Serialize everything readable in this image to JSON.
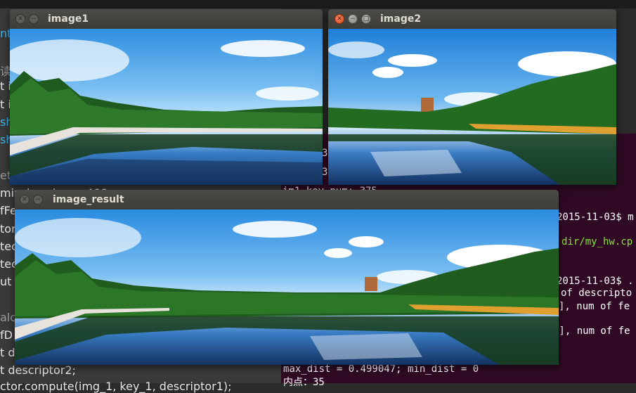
{
  "editor": {
    "lines": [
      {
        "text": "nt",
        "style": "blue"
      },
      {
        "text": "读入",
        "style": "gray"
      },
      {
        "text": "t i",
        "style": ""
      },
      {
        "text": "t i",
        "style": ""
      },
      {
        "text": "sh",
        "style": "blue"
      },
      {
        "text": "sh",
        "style": "blue"
      },
      {
        "text": "et",
        "style": "gray"
      },
      {
        "text": "min_hessian = 400",
        "style": ""
      },
      {
        "text": "fFe",
        "style": ""
      },
      {
        "text": "tor",
        "style": ""
      },
      {
        "text": "tec",
        "style": ""
      },
      {
        "text": "tec",
        "style": ""
      },
      {
        "text": "ut <",
        "style": ""
      },
      {
        "text": "alc",
        "style": "gray"
      },
      {
        "text": "fD",
        "style": ""
      },
      {
        "text": "t d",
        "style": ""
      },
      {
        "text": "t descriptor2;",
        "style": ""
      },
      {
        "text": "ctor.compute(img_1, key_1, descriptor1);",
        "style": ""
      }
    ]
  },
  "terminal": {
    "lines": [
      {
        "text": "3",
        "style": ""
      },
      {
        "text": "3",
        "style": ""
      },
      {
        "text": "im1 key num: 375",
        "style": ""
      },
      {
        "text": "2015-11-03$ m",
        "style": ""
      },
      {
        "text": "dir/my_hw.cp",
        "style": "green"
      },
      {
        "text": "2015-11-03$ .",
        "style": ""
      },
      {
        "text": "of descripto",
        "style": ""
      },
      {
        "text": "], num of fe",
        "style": ""
      },
      {
        "text": "4], num of fe",
        "style": ""
      },
      {
        "text": "max_dist = 0.499047; min_dist = 0",
        "style": ""
      },
      {
        "text": "内点：35",
        "style": ""
      }
    ]
  },
  "windows": {
    "image1": {
      "title": "image1"
    },
    "image2": {
      "title": "image2"
    },
    "image_result": {
      "title": "image_result"
    }
  }
}
